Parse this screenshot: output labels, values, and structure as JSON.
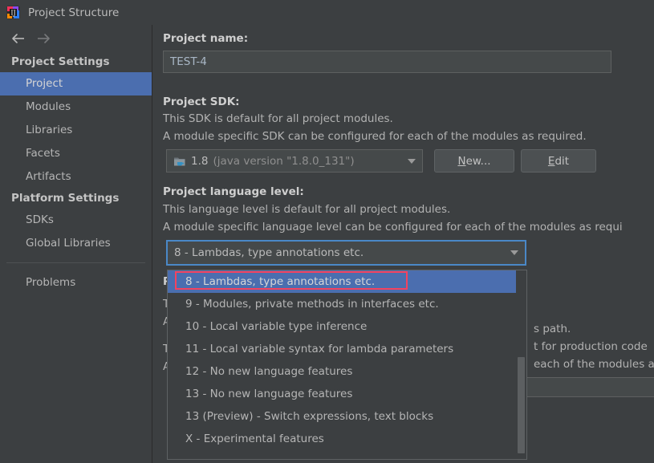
{
  "window": {
    "title": "Project Structure",
    "app_icon": "intellij-idea-logo"
  },
  "sidebar": {
    "nav": {
      "back_icon": "arrow-left-icon",
      "forward_icon": "arrow-right-icon"
    },
    "groups": [
      {
        "header": "Project Settings",
        "items": [
          {
            "label": "Project",
            "selected": true
          },
          {
            "label": "Modules",
            "selected": false
          },
          {
            "label": "Libraries",
            "selected": false
          },
          {
            "label": "Facets",
            "selected": false
          },
          {
            "label": "Artifacts",
            "selected": false
          }
        ]
      },
      {
        "header": "Platform Settings",
        "items": [
          {
            "label": "SDKs",
            "selected": false
          },
          {
            "label": "Global Libraries",
            "selected": false
          }
        ]
      }
    ],
    "footer_items": [
      {
        "label": "Problems",
        "selected": false
      }
    ]
  },
  "main": {
    "project_name": {
      "label": "Project name:",
      "value": "TEST-4",
      "placeholder": ""
    },
    "project_sdk": {
      "label": "Project SDK:",
      "desc_line_1": "This SDK is default for all project modules.",
      "desc_line_2": "A module specific SDK can be configured for each of the modules as required.",
      "selected_version": "1.8",
      "selected_detail": "(java version \"1.8.0_131\")",
      "icon": "sdk-folder-java-icon",
      "dropdown_icon": "chevron-down-icon",
      "new_button": {
        "label": "New...",
        "mnemonic": "N"
      },
      "edit_button": {
        "label": "Edit",
        "mnemonic": "E"
      }
    },
    "project_language_level": {
      "label": "Project language level:",
      "desc_line_1": "This language level is default for all project modules.",
      "desc_line_2": "A module specific language level can be configured for each of the modules as requi",
      "selected": "8 - Lambdas, type annotations etc.",
      "dropdown_icon": "chevron-down-icon",
      "options": [
        "8 - Lambdas, type annotations etc.",
        "9 - Modules, private methods in interfaces etc.",
        "10 - Local variable type inference",
        "11 - Local variable syntax for lambda parameters",
        "12 - No new language features",
        "13 - No new language features",
        "13 (Preview) - Switch expressions, text blocks",
        "X - Experimental features"
      ],
      "highlighted_option_index": 0
    },
    "obscured_section": {
      "label_fragment": "P",
      "line_fragments": [
        "T",
        "A",
        "T",
        "A"
      ],
      "right_fragment_1": "s path.",
      "right_fragment_2": "t for production code",
      "right_fragment_3": "each of the modules a"
    }
  },
  "annotation": {
    "type": "highlight-rectangle",
    "color": "#f4435f",
    "target": "8 - Lambdas, type annotations etc."
  },
  "colors": {
    "background": "#3c3f41",
    "selection_blue": "#4b6eaf",
    "focus_border": "#4a88c7",
    "input_background": "#45494a",
    "text": "#b5b5b5",
    "annotation_red": "#f4435f"
  }
}
